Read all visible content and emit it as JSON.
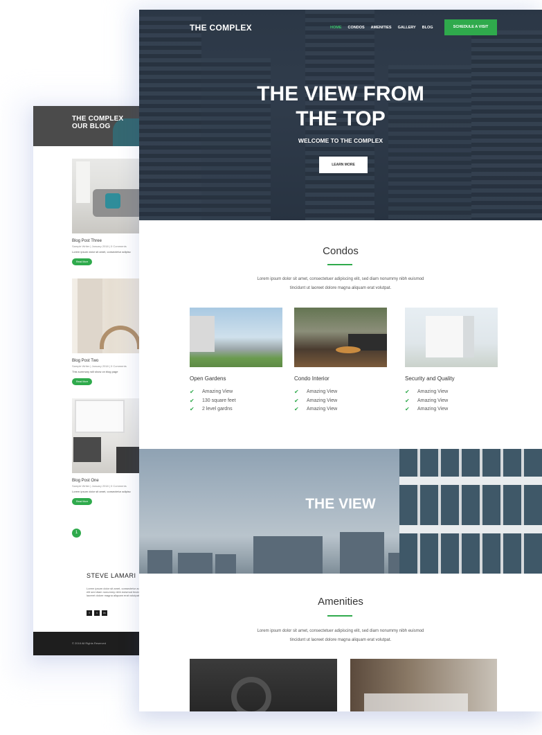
{
  "blog_page": {
    "header_title_line1": "THE COMPLEX",
    "header_title_line2": "OUR BLOG",
    "posts": [
      {
        "title": "Blog Post Three",
        "meta": "Sample Writer | January 2018 | 0 Comments",
        "excerpt": "Lorem ipsum dolor sit amet, consectetur adipisc",
        "button": "Read More"
      },
      {
        "title": "Blog Post Two",
        "meta": "Sample Writer | January 2018 | 0 Comments",
        "excerpt": "This summary will show on blog page",
        "button": "Read More"
      },
      {
        "title": "Blog Post One",
        "meta": "Sample Writer | January 2018 | 0 Comments",
        "excerpt": "Lorem ipsum dolor sit amet, consectetur adipisc",
        "button": "Read More"
      }
    ],
    "pagination_current": "1",
    "author_name": "STEVE LAMARI",
    "author_bio": "Lorem ipsum dolor sit amet, consectetur adipiscing elit sed diam nonummy nibh euismod tincidunt ut laoreet dolore magna aliquam erat volutpat.",
    "social_icons": [
      "f",
      "t",
      "in"
    ],
    "footer_text": "© 2018 All Rights Reserved"
  },
  "site": {
    "brand": "THE COMPLEX",
    "nav": [
      "HOME",
      "CONDOS",
      "AMENITIES",
      "GALLERY",
      "BLOG"
    ],
    "nav_active": "HOME",
    "cta": "SCHEDULE A VISIT",
    "accent_color": "#2faa4c"
  },
  "hero": {
    "title_line1": "THE VIEW FROM",
    "title_line2": "THE TOP",
    "subtitle": "WELCOME TO THE COMPLEX",
    "button": "LEARN MORE"
  },
  "condos": {
    "title": "Condos",
    "lede_line1": "Lorem ipsum dolor sit amet, consectetuer adipiscing elit, sed diam nonummy nibh euismod",
    "lede_line2": "tincidunt ut laoreet dolore magna aliquam erat volutpat.",
    "cards": [
      {
        "title": "Open Gardens",
        "features": [
          "Amazing View",
          "130 square feet",
          "2 level gardns"
        ]
      },
      {
        "title": "Condo Interior",
        "features": [
          "Amazing View",
          "Amazing View",
          "Amazing View"
        ]
      },
      {
        "title": "Security and Quality",
        "features": [
          "Amazing View",
          "Amazing View",
          "Amazing View"
        ]
      }
    ]
  },
  "view_banner": {
    "title": "THE VIEW"
  },
  "amenities": {
    "title": "Amenities",
    "lede_line1": "Lorem ipsum dolor sit amet, consectetuer adipiscing elit, sed diam nonummy nibh euismod",
    "lede_line2": "tincidunt ut laoreet dolore magna aliquam erat volutpat."
  }
}
